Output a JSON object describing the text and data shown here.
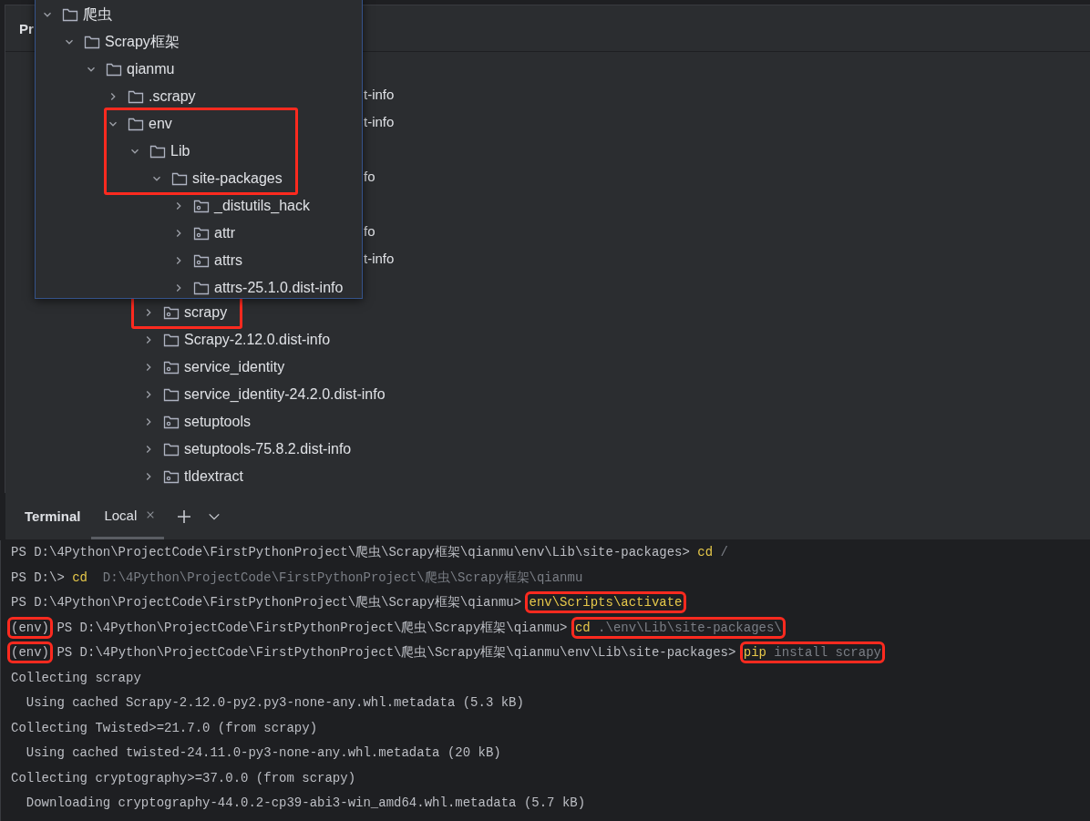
{
  "project_panel": {
    "header": "Pr",
    "covered_rows": [
      {
        "kind": "fragment",
        "text": "t-info"
      },
      {
        "kind": "fragment",
        "text": "t-info"
      },
      {
        "kind": "blank"
      },
      {
        "kind": "fragment",
        "text": "fo"
      },
      {
        "kind": "blank"
      },
      {
        "kind": "fragment",
        "text": "fo"
      },
      {
        "kind": "fragment",
        "text": "t-info"
      },
      {
        "kind": "blank"
      }
    ],
    "rows": [
      {
        "name": "scrapy",
        "kind": "package",
        "expanded": false,
        "marked": true
      },
      {
        "name": "Scrapy-2.12.0.dist-info",
        "kind": "folder",
        "expanded": false,
        "marked": false
      },
      {
        "name": "service_identity",
        "kind": "package",
        "expanded": false,
        "marked": false
      },
      {
        "name": "service_identity-24.2.0.dist-info",
        "kind": "folder",
        "expanded": false,
        "marked": false
      },
      {
        "name": "setuptools",
        "kind": "package",
        "expanded": false,
        "marked": false
      },
      {
        "name": "setuptools-75.8.2.dist-info",
        "kind": "folder",
        "expanded": false,
        "marked": false
      },
      {
        "name": "tldextract",
        "kind": "package",
        "expanded": false,
        "marked": false
      }
    ]
  },
  "popup_tree": [
    {
      "name": "爬虫",
      "kind": "folder",
      "expanded": true,
      "marked": false,
      "children": [
        {
          "name": "Scrapy框架",
          "kind": "folder",
          "expanded": true,
          "marked": false,
          "children": [
            {
              "name": "qianmu",
              "kind": "folder",
              "expanded": true,
              "marked": false,
              "children": [
                {
                  "name": ".scrapy",
                  "kind": "folder",
                  "expanded": false,
                  "marked": false
                },
                {
                  "name": "env",
                  "kind": "folder",
                  "expanded": true,
                  "marked": true,
                  "children": [
                    {
                      "name": "Lib",
                      "kind": "folder",
                      "expanded": true,
                      "marked": true,
                      "children": [
                        {
                          "name": "site-packages",
                          "kind": "folder",
                          "expanded": true,
                          "marked": true,
                          "children": [
                            {
                              "name": "_distutils_hack",
                              "kind": "package",
                              "expanded": false,
                              "marked": false
                            },
                            {
                              "name": "attr",
                              "kind": "package",
                              "expanded": false,
                              "marked": false
                            },
                            {
                              "name": "attrs",
                              "kind": "package",
                              "expanded": false,
                              "marked": false
                            },
                            {
                              "name": "attrs-25.1.0.dist-info",
                              "kind": "folder",
                              "expanded": false,
                              "marked": false
                            }
                          ]
                        }
                      ]
                    }
                  ]
                }
              ]
            }
          ]
        }
      ]
    }
  ],
  "terminal": {
    "title": "Terminal",
    "tabs": [
      {
        "label": "Local",
        "selected": true
      }
    ],
    "lines": [
      {
        "segments": [
          {
            "kind": "prompt",
            "text": "PS D:\\4Python\\ProjectCode\\FirstPythonProject\\爬虫\\Scrapy框架\\qianmu\\env\\Lib\\site-packages> ",
            "marked": false
          },
          {
            "kind": "command",
            "text": "cd",
            "marked": false
          },
          {
            "kind": "arg",
            "text": " /",
            "marked": false
          }
        ]
      },
      {
        "segments": [
          {
            "kind": "prompt",
            "text": "PS D:\\> ",
            "marked": false
          },
          {
            "kind": "command",
            "text": "cd",
            "marked": false
          },
          {
            "kind": "arg",
            "text": "  D:\\4Python\\ProjectCode\\FirstPythonProject\\爬虫\\Scrapy框架\\qianmu",
            "marked": false
          }
        ]
      },
      {
        "segments": [
          {
            "kind": "prompt",
            "text": "PS D:\\4Python\\ProjectCode\\FirstPythonProject\\爬虫\\Scrapy框架\\qianmu> ",
            "marked": false
          },
          {
            "kind": "command",
            "text": "env\\Scripts\\activate",
            "marked": true
          }
        ]
      },
      {
        "segments": [
          {
            "kind": "prompt",
            "text": "(env)",
            "marked": true
          },
          {
            "kind": "prompt",
            "text": " PS D:\\4Python\\ProjectCode\\FirstPythonProject\\爬虫\\Scrapy框架\\qianmu> ",
            "marked": false
          },
          {
            "kind": "command",
            "text": "cd",
            "marked": true
          },
          {
            "kind": "arg",
            "text": " .\\env\\Lib\\site-packages\\",
            "marked": true
          }
        ]
      },
      {
        "segments": [
          {
            "kind": "prompt",
            "text": "(env)",
            "marked": true
          },
          {
            "kind": "prompt",
            "text": " PS D:\\4Python\\ProjectCode\\FirstPythonProject\\爬虫\\Scrapy框架\\qianmu\\env\\Lib\\site-packages> ",
            "marked": false
          },
          {
            "kind": "command",
            "text": "pip",
            "marked": true
          },
          {
            "kind": "arg",
            "text": " install scrapy",
            "marked": true
          }
        ]
      },
      {
        "segments": [
          {
            "kind": "output",
            "text": "Collecting scrapy",
            "marked": false
          }
        ]
      },
      {
        "segments": [
          {
            "kind": "output",
            "text": "  Using cached Scrapy-2.12.0-py2.py3-none-any.whl.metadata (5.3 kB)",
            "marked": false
          }
        ]
      },
      {
        "segments": [
          {
            "kind": "output",
            "text": "Collecting Twisted>=21.7.0 (from scrapy)",
            "marked": false
          }
        ]
      },
      {
        "segments": [
          {
            "kind": "output",
            "text": "  Using cached twisted-24.11.0-py3-none-any.whl.metadata (20 kB)",
            "marked": false
          }
        ]
      },
      {
        "segments": [
          {
            "kind": "output",
            "text": "Collecting cryptography>=37.0.0 (from scrapy)",
            "marked": false
          }
        ]
      },
      {
        "segments": [
          {
            "kind": "output",
            "text": "  Downloading cryptography-44.0.2-cp39-abi3-win_amd64.whl.metadata (5.7 kB)",
            "marked": false
          }
        ]
      }
    ]
  }
}
